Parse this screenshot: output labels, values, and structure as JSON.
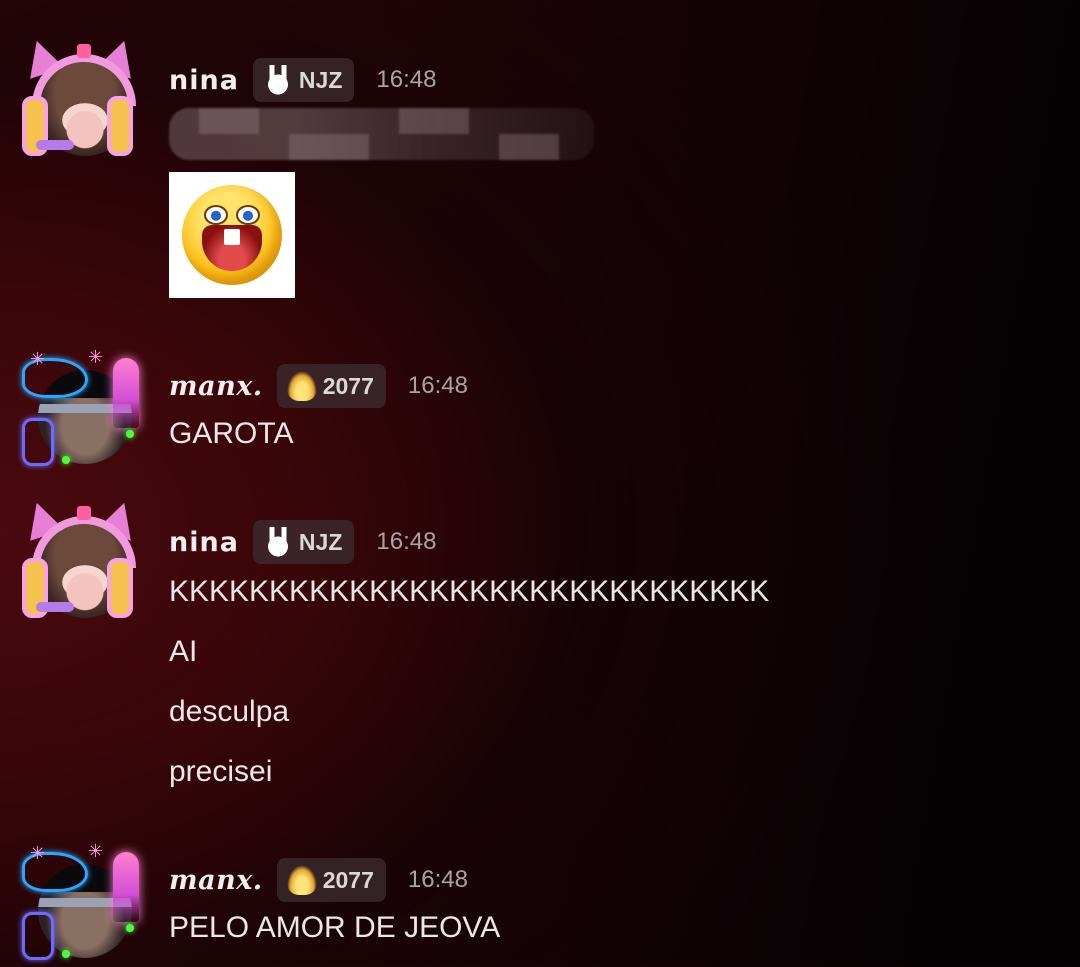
{
  "messages": [
    {
      "user": "nina",
      "tag_label": "NJZ",
      "tag_icon": "bunny-icon",
      "time": "16:48",
      "lines": [],
      "has_redacted_text": true,
      "has_emoji_image": true
    },
    {
      "user": "manx.",
      "tag_label": "2077",
      "tag_icon": "flame-icon",
      "time": "16:48",
      "lines": [
        "GAROTA"
      ]
    },
    {
      "user": "nina",
      "tag_label": "NJZ",
      "tag_icon": "bunny-icon",
      "time": "16:48",
      "lines": [
        "KKKKKKKKKKKKKKKKKKKKKKKKKKKKKK",
        "AI",
        "desculpa",
        "precisei"
      ]
    },
    {
      "user": "manx.",
      "tag_label": "2077",
      "tag_icon": "flame-icon",
      "time": "16:48",
      "lines": [
        "PELO AMOR DE JEOVA"
      ]
    }
  ],
  "colors": {
    "background_accent": "#4a0a0f",
    "text": "#ece8ea",
    "timestamp": "#a9a3a7",
    "tag_background": "#3c2d32"
  }
}
